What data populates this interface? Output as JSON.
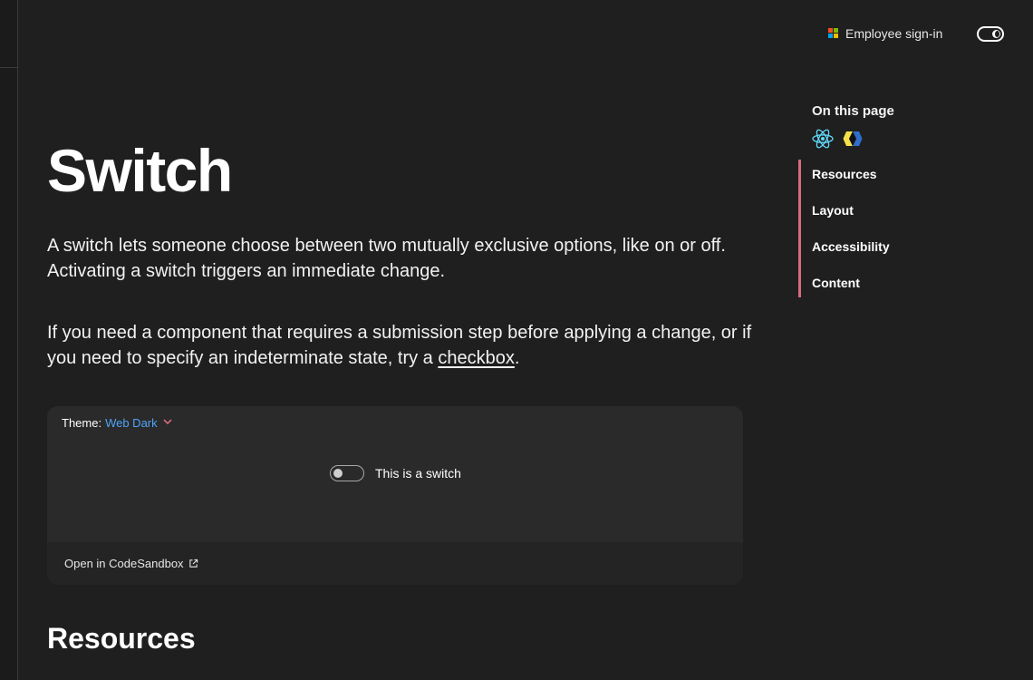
{
  "header": {
    "signin_label": "Employee sign-in",
    "logo_colors": [
      "#f25022",
      "#7fba00",
      "#00a4ef",
      "#ffb900"
    ]
  },
  "page": {
    "title": "Switch",
    "intro": "A switch lets someone choose between two mutually exclusive options, like on or off. Activating a switch triggers an immediate change.",
    "intro2_prefix": "If you need a component that requires a submission step before applying a change, or if you need to specify an indeterminate state, try a ",
    "intro2_link": "checkbox",
    "intro2_suffix": "."
  },
  "demo": {
    "theme_label": "Theme:",
    "theme_value": "Web Dark",
    "switch_label": "This is a switch",
    "switch_checked": false,
    "sandbox_label": "Open in CodeSandbox"
  },
  "resources_heading": "Resources",
  "toc": {
    "title": "On this page",
    "icons": [
      "react-icon",
      "web-components-icon"
    ],
    "items": [
      "Resources",
      "Layout",
      "Accessibility",
      "Content"
    ],
    "accent_color": "#d56b82"
  }
}
